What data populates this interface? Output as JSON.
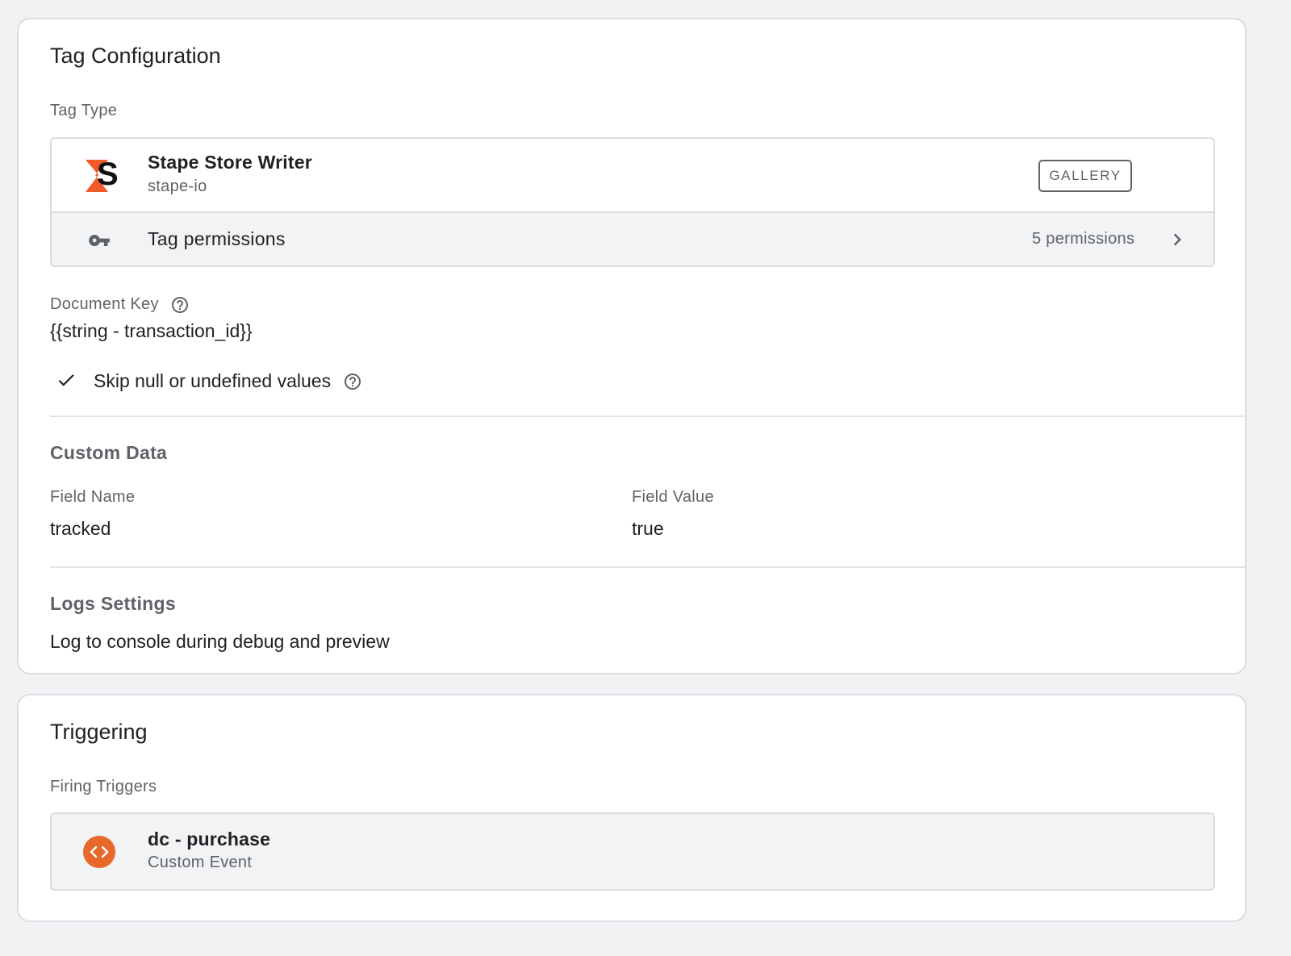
{
  "tag_configuration": {
    "title": "Tag Configuration",
    "tag_type_label": "Tag Type",
    "tag": {
      "name": "Stape Store Writer",
      "vendor": "stape-io",
      "logo_letter": "S",
      "gallery_button": "GALLERY"
    },
    "permissions": {
      "label": "Tag permissions",
      "count": "5 permissions"
    },
    "document_key": {
      "label": "Document Key",
      "value": "{{string - transaction_id}}"
    },
    "skip_null": {
      "label": "Skip null or undefined values"
    },
    "custom_data": {
      "title": "Custom Data",
      "field_name_header": "Field Name",
      "field_value_header": "Field Value",
      "rows": [
        {
          "name": "tracked",
          "value": "true"
        }
      ]
    },
    "logs_settings": {
      "title": "Logs Settings",
      "value": "Log to console during debug and preview"
    }
  },
  "triggering": {
    "title": "Triggering",
    "firing_triggers_label": "Firing Triggers",
    "trigger": {
      "name": "dc - purchase",
      "type": "Custom Event"
    }
  },
  "colors": {
    "brand_orange": "#f15a29",
    "trigger_orange": "#e8672b",
    "page_bg": "#f1f2f4"
  }
}
